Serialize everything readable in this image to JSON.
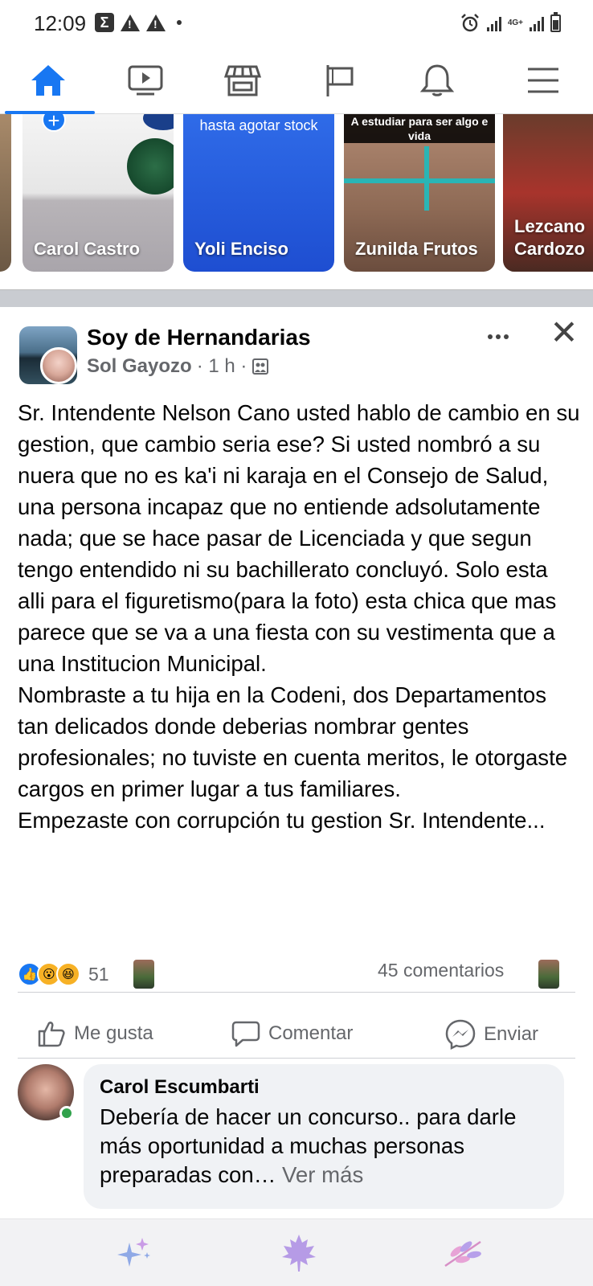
{
  "status_bar": {
    "time": "12:09",
    "network": "4G+",
    "icons": [
      "sigma-icon",
      "warning-icon",
      "warning-icon",
      "dot-icon",
      "alarm-icon",
      "signal-icon",
      "signal-icon",
      "battery-icon"
    ]
  },
  "nav": {
    "items": [
      {
        "name": "home",
        "icon": "home-icon",
        "active": true
      },
      {
        "name": "watch",
        "icon": "video-icon"
      },
      {
        "name": "marketplace",
        "icon": "store-icon"
      },
      {
        "name": "pages",
        "icon": "flag-icon"
      },
      {
        "name": "notifications",
        "icon": "bell-icon"
      },
      {
        "name": "menu",
        "icon": "hamburger-icon"
      }
    ],
    "accent_color": "#1877f2"
  },
  "stories": [
    {
      "name": "Carol Castro",
      "caption": ""
    },
    {
      "name": "Yoli Enciso",
      "caption": "hasta agotar stock"
    },
    {
      "name": "Zunilda Frutos",
      "caption": "A estudiar para ser algo e vida"
    },
    {
      "name": "Lezcano Cardozo",
      "caption": ""
    }
  ],
  "post": {
    "group": "Soy de Hernandarias",
    "author": "Sol Gayozo",
    "time": "· 1 h ·",
    "text": "Sr. Intendente Nelson Cano usted hablo de cambio en su gestion, que cambio seria ese? Si usted nombró a su nuera que no es ka'i ni karaja en el Consejo de Salud, una persona incapaz que no entiende adsolutamente nada; que se hace pasar de Licenciada y que segun tengo entendido ni su bachillerato concluyó. Solo esta alli para el figuretismo(para la foto) esta chica que mas parece que se va a una fiesta con su vestimenta que a una Institucion Municipal.\nNombraste a tu hija en la Codeni, dos Departamentos tan delicados donde deberias nombrar gentes profesionales; no tuviste en cuenta meritos, le otorgaste cargos en primer lugar a tus familiares.\nEmpezaste con corrupción tu gestion Sr. Intendente...",
    "reaction_count": "51",
    "comments_count": "45 comentarios",
    "actions": {
      "like": "Me gusta",
      "comment": "Comentar",
      "share": "Enviar"
    }
  },
  "comment": {
    "author": "Carol Escumbarti",
    "text": "Debería de hacer un concurso.. para darle más oportunidad a muchas personas preparadas con…",
    "see_more": "Ver más"
  }
}
